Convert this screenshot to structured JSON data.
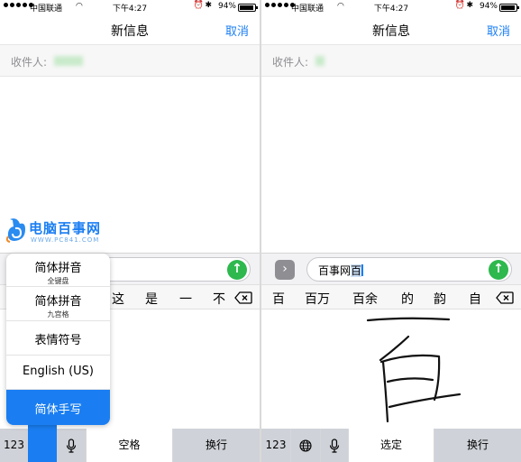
{
  "status_bar": {
    "carrier": "中国联通",
    "time": "下午4:27",
    "battery": "94%"
  },
  "nav": {
    "title": "新信息",
    "cancel_label": "取消"
  },
  "recipient": {
    "label": "收件人:"
  },
  "left": {
    "candidates": [
      "这",
      "是",
      "一",
      "不"
    ],
    "input_menu": [
      {
        "label": "简体拼音",
        "sub": "全键盘"
      },
      {
        "label": "简体拼音",
        "sub": "九宫格"
      },
      {
        "label": "表情符号"
      },
      {
        "label": "English (US)"
      },
      {
        "label": "简体手写",
        "active": true
      }
    ],
    "keys": {
      "num": "123",
      "space": "空格",
      "return": "换行"
    }
  },
  "right": {
    "message_text": "百事网",
    "message_highlight": "百",
    "candidates": [
      "百",
      "百万",
      "百余",
      "的",
      "韵",
      "自"
    ],
    "keys": {
      "num": "123",
      "select": "选定",
      "return": "换行"
    }
  },
  "watermark": {
    "name": "电脑百事网",
    "url": "WWW.PC841.COM"
  },
  "colors": {
    "accent": "#1a7ef2",
    "send": "#2eb84e"
  }
}
